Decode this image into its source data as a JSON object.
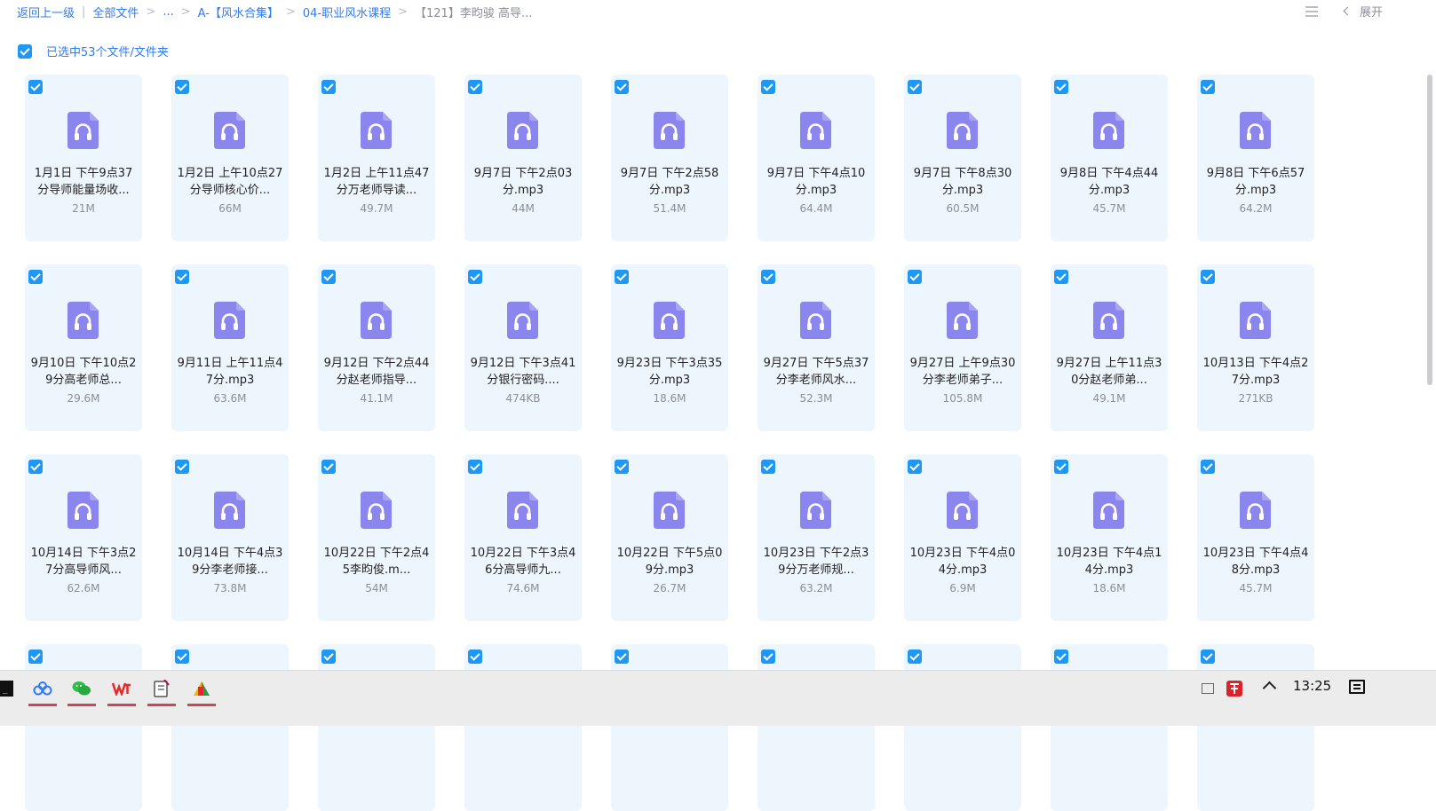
{
  "breadcrumb": {
    "items": [
      "返回上一级",
      "全部文件",
      "...",
      "A-【风水合集】",
      "04-职业风水课程"
    ],
    "separators": [
      "|",
      ">",
      ">",
      ">",
      ">"
    ],
    "current": "【121】李昀骏 高导..."
  },
  "toolbar": {
    "expand_label": "展开"
  },
  "selection": {
    "text": "已选中53个文件/文件夹"
  },
  "files": [
    {
      "name": "1月1日 下午9点37分导师能量场收...",
      "size": "21M"
    },
    {
      "name": "1月2日 上午10点27分导师核心价...",
      "size": "66M"
    },
    {
      "name": "1月2日 上午11点47分万老师导读...",
      "size": "49.7M"
    },
    {
      "name": "9月7日 下午2点03分.mp3",
      "size": "44M"
    },
    {
      "name": "9月7日 下午2点58分.mp3",
      "size": "51.4M"
    },
    {
      "name": "9月7日 下午4点10分.mp3",
      "size": "64.4M"
    },
    {
      "name": "9月7日 下午8点30分.mp3",
      "size": "60.5M"
    },
    {
      "name": "9月8日 下午4点44分.mp3",
      "size": "45.7M"
    },
    {
      "name": "9月8日 下午6点57分.mp3",
      "size": "64.2M"
    },
    {
      "name": "9月10日 下午10点29分高老师总...",
      "size": "29.6M"
    },
    {
      "name": "9月11日 上午11点47分.mp3",
      "size": "63.6M"
    },
    {
      "name": "9月12日 下午2点44分赵老师指导...",
      "size": "41.1M"
    },
    {
      "name": "9月12日 下午3点41分银行密码....",
      "size": "474KB"
    },
    {
      "name": "9月23日 下午3点35分.mp3",
      "size": "18.6M"
    },
    {
      "name": "9月27日 下午5点37分李老师风水...",
      "size": "52.3M"
    },
    {
      "name": "9月27日 上午9点30分李老师弟子...",
      "size": "105.8M"
    },
    {
      "name": "9月27日 上午11点30分赵老师弟...",
      "size": "49.1M"
    },
    {
      "name": "10月13日 下午4点27分.mp3",
      "size": "271KB"
    },
    {
      "name": "10月14日 下午3点27分高导师风...",
      "size": "62.6M"
    },
    {
      "name": "10月14日 下午4点39分李老师接...",
      "size": "73.8M"
    },
    {
      "name": "10月22日 下午2点45李昀俊.m...",
      "size": "54M"
    },
    {
      "name": "10月22日 下午3点46分高导师九...",
      "size": "74.6M"
    },
    {
      "name": "10月22日 下午5点09分.mp3",
      "size": "26.7M"
    },
    {
      "name": "10月23日 下午2点39分万老师规...",
      "size": "63.2M"
    },
    {
      "name": "10月23日 下午4点04分.mp3",
      "size": "6.9M"
    },
    {
      "name": "10月23日 下午4点14分.mp3",
      "size": "18.6M"
    },
    {
      "name": "10月23日 下午4点48分.mp3",
      "size": "45.7M"
    },
    {
      "name": "",
      "size": ""
    },
    {
      "name": "",
      "size": ""
    },
    {
      "name": "",
      "size": ""
    },
    {
      "name": "",
      "size": ""
    },
    {
      "name": "",
      "size": ""
    },
    {
      "name": "",
      "size": ""
    },
    {
      "name": "",
      "size": ""
    },
    {
      "name": "",
      "size": ""
    },
    {
      "name": "",
      "size": ""
    }
  ],
  "taskbar": {
    "clock": "13:25",
    "apps": [
      "terminal-icon",
      "baidu-netdisk-icon",
      "wechat-icon",
      "wps-icon",
      "notes-icon",
      "paint-icon"
    ]
  },
  "colors": {
    "accent": "#2f7bf5",
    "checkbox": "#1f97f5",
    "card_bg": "#eef6fd",
    "audio_icon": "#8b86ee"
  }
}
